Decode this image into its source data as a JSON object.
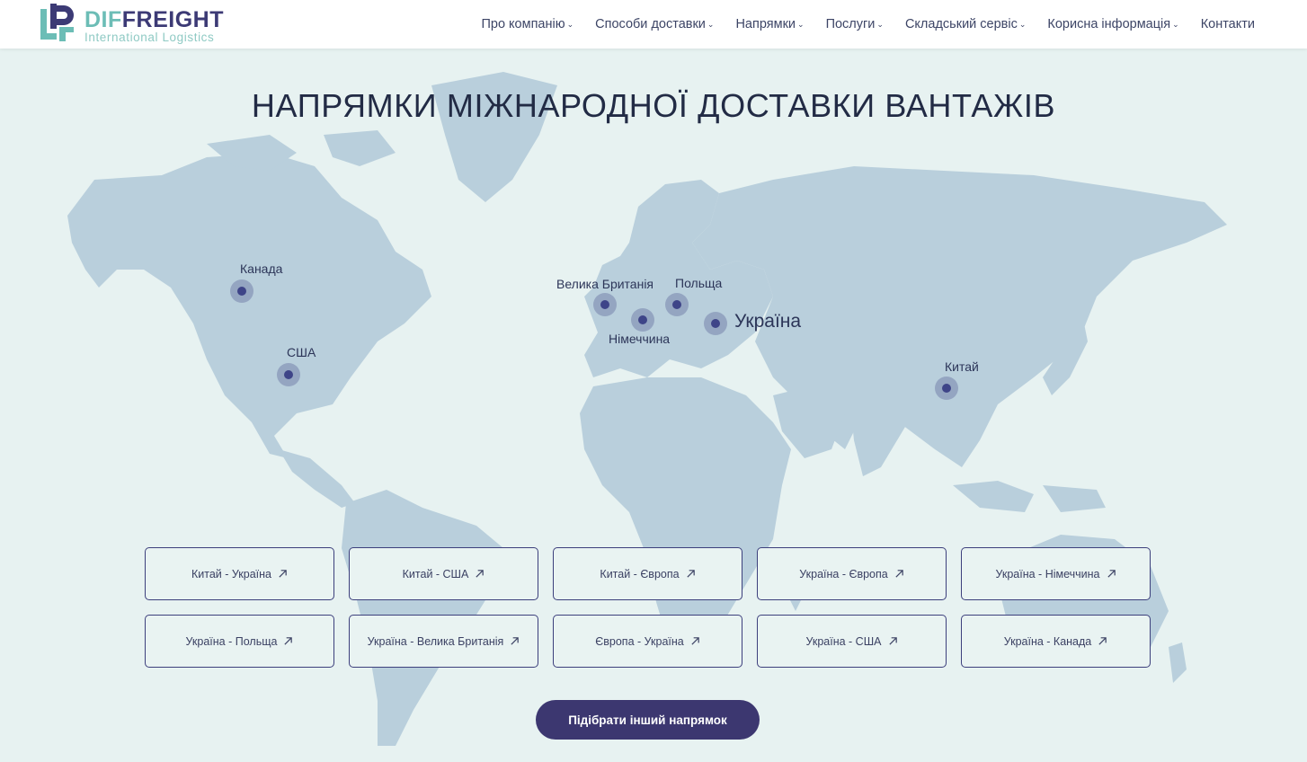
{
  "logo": {
    "brand_part1": "DIF",
    "brand_part2": "FREIGHT",
    "tagline": "International Logistics"
  },
  "nav": [
    {
      "label": "Про компанію",
      "dropdown": true
    },
    {
      "label": "Способи доставки",
      "dropdown": true
    },
    {
      "label": "Напрямки",
      "dropdown": true
    },
    {
      "label": "Послуги",
      "dropdown": true
    },
    {
      "label": "Складський сервіс",
      "dropdown": true
    },
    {
      "label": "Корисна інформація",
      "dropdown": true
    },
    {
      "label": "Контакти",
      "dropdown": false
    }
  ],
  "page_title": "НАПРЯМКИ МІЖНАРОДНОЇ ДОСТАВКИ ВАНТАЖІВ",
  "markers": {
    "canada": "Канада",
    "usa": "США",
    "uk": "Велика Британія",
    "poland": "Польща",
    "germany": "Німеччина",
    "ukraine": "Україна",
    "china": "Китай"
  },
  "routes": [
    "Китай - Україна",
    "Китай - США",
    "Китай - Європа",
    "Україна - Європа",
    "Україна - Німеччина",
    "Україна - Польща",
    "Україна - Велика Британія",
    "Європа - Україна",
    "Україна - США",
    "Україна - Канада"
  ],
  "cta_label": "Підібрати інший напрямок",
  "colors": {
    "accent": "#3c3770",
    "teal": "#6cbdb6",
    "background": "#e7f2f1",
    "land": "#b9cfdc"
  }
}
